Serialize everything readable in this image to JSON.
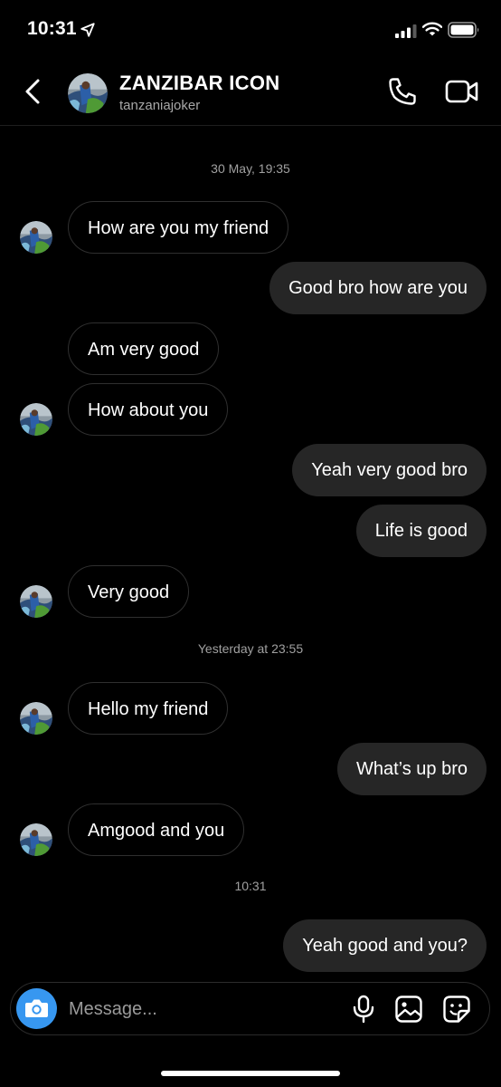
{
  "status_bar": {
    "time": "10:31",
    "icons": [
      "location-arrow-icon",
      "cellular-signal-icon",
      "wifi-icon",
      "battery-icon"
    ]
  },
  "header": {
    "contact_name": "ZANZIBAR ICON",
    "contact_handle": "tanzaniajoker",
    "icons": [
      "back-chevron-icon",
      "avatar",
      "phone-icon",
      "video-camera-icon"
    ]
  },
  "conversation": {
    "timestamps": [
      "30 May, 19:35",
      "Yesterday at 23:55",
      "10:31"
    ],
    "messages": [
      {
        "sender": "contact",
        "text": "How are you my friend"
      },
      {
        "sender": "me",
        "text": "Good bro how are you"
      },
      {
        "sender": "contact",
        "text": "Am very good"
      },
      {
        "sender": "contact",
        "text": "How about you"
      },
      {
        "sender": "me",
        "text": "Yeah very good bro"
      },
      {
        "sender": "me",
        "text": "Life is good"
      },
      {
        "sender": "contact",
        "text": "Very good"
      },
      {
        "sender": "contact",
        "text": "Hello my friend"
      },
      {
        "sender": "me",
        "text": "What’s up bro"
      },
      {
        "sender": "contact",
        "text": "Amgood and you"
      },
      {
        "sender": "me",
        "text": "Yeah good and you?"
      }
    ]
  },
  "composer": {
    "placeholder": "Message...",
    "value": "",
    "icons": [
      "camera-icon",
      "microphone-icon",
      "gallery-icon",
      "sticker-icon"
    ]
  },
  "colors": {
    "background": "#000000",
    "outgoing_bubble": "#262626",
    "incoming_border": "#2f2f2f",
    "camera_accent": "#3797f0",
    "secondary_text": "#a8a8a8"
  }
}
